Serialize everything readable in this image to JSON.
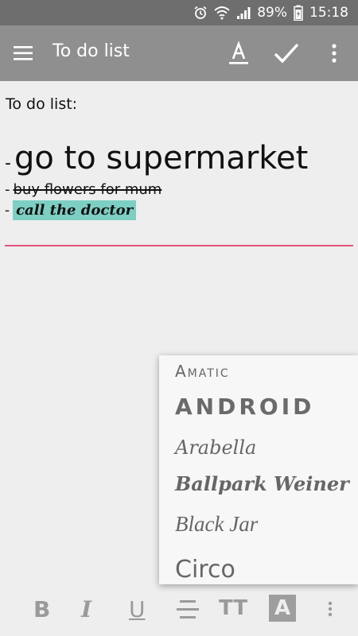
{
  "status_bar": {
    "battery": "89%",
    "time": "15:18",
    "icons": [
      "alarm-icon",
      "wifi-icon",
      "signal-icon",
      "battery-icon"
    ]
  },
  "app_bar": {
    "title": "To do list",
    "icons": [
      "menu-icon",
      "text-format-icon",
      "check-icon",
      "more-vert-icon"
    ]
  },
  "note": {
    "heading": "To do list:",
    "items": [
      {
        "dash": "-",
        "text": "go to supermarket"
      },
      {
        "dash": "-",
        "text": "buy flowers for mum"
      },
      {
        "dash": "-",
        "text": "call the doctor"
      }
    ],
    "colors": {
      "highlight": "#7dcfc3",
      "accent": "#e2527a"
    }
  },
  "font_menu": {
    "options": [
      "Amatic",
      "ANDROID",
      "Arabella",
      "Ballpark Weiner",
      "Black Jar",
      "Circo"
    ]
  },
  "format_toolbar": {
    "bold": "B",
    "italic": "I",
    "underline": "U",
    "size": "TT",
    "color": "A",
    "icons": [
      "bold-icon",
      "italic-icon",
      "underline-icon",
      "strikethrough-icon",
      "text-size-icon",
      "text-color-icon",
      "more-vert-icon"
    ]
  }
}
